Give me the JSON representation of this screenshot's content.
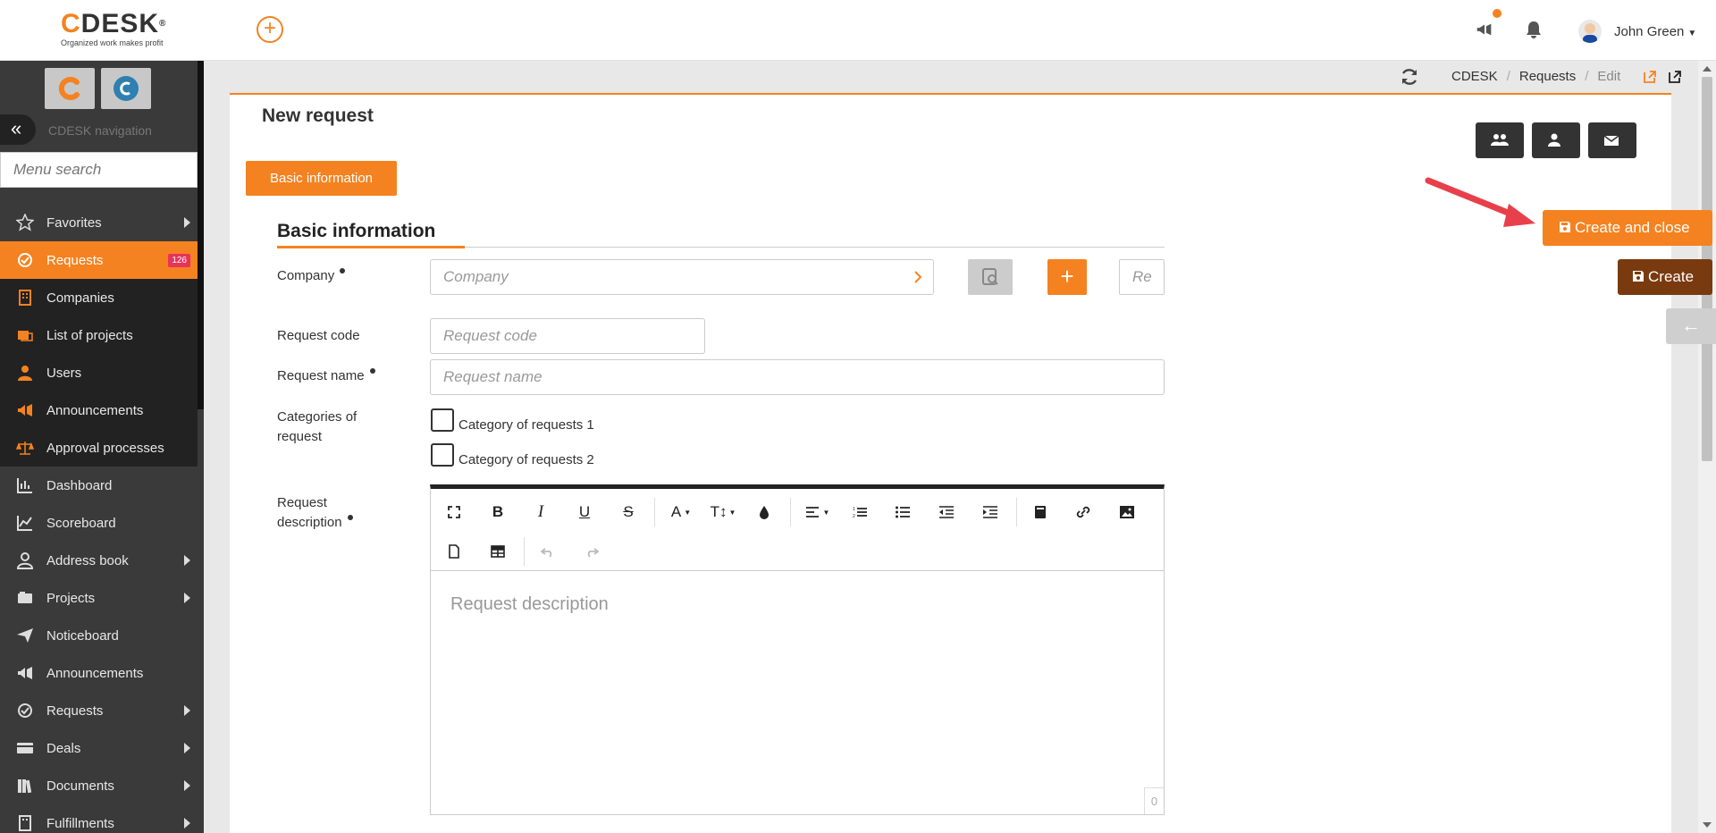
{
  "header": {
    "logo_text": "DESK",
    "logo_letter": "C",
    "logo_trademark": "®",
    "tagline": "Organized work makes profit",
    "user_name": "John Green"
  },
  "sidebar": {
    "nav_label": "CDESK navigation",
    "search_placeholder": "Menu search",
    "items": [
      {
        "label": "Favorites",
        "icon": "star-icon",
        "arrow": true
      },
      {
        "label": "Requests",
        "icon": "requests-icon",
        "badge": "126",
        "active": true
      },
      {
        "label": "Companies",
        "icon": "building-icon"
      },
      {
        "label": "List of projects",
        "icon": "projects-list-icon"
      },
      {
        "label": "Users",
        "icon": "user-icon"
      },
      {
        "label": "Announcements",
        "icon": "megaphone-icon"
      },
      {
        "label": "Approval processes",
        "icon": "scales-icon"
      },
      {
        "label": "Dashboard",
        "icon": "dashboard-icon"
      },
      {
        "label": "Scoreboard",
        "icon": "chart-line-icon"
      },
      {
        "label": "Address book",
        "icon": "address-book-icon",
        "arrow": true
      },
      {
        "label": "Projects",
        "icon": "projects-icon",
        "arrow": true
      },
      {
        "label": "Noticeboard",
        "icon": "paper-plane-icon"
      },
      {
        "label": "Announcements",
        "icon": "megaphone-outline-icon"
      },
      {
        "label": "Requests",
        "icon": "requests-outline-icon",
        "arrow": true
      },
      {
        "label": "Deals",
        "icon": "card-icon",
        "arrow": true
      },
      {
        "label": "Documents",
        "icon": "books-icon",
        "arrow": true
      },
      {
        "label": "Fulfillments",
        "icon": "building-outline-icon",
        "arrow": true
      }
    ]
  },
  "breadcrumb": {
    "items": [
      "CDESK",
      "Requests",
      "Edit"
    ]
  },
  "page": {
    "title": "New request",
    "tab_label": "Basic information",
    "section_title": "Basic information"
  },
  "form": {
    "company_label": "Company",
    "company_placeholder": "Company",
    "re_placeholder": "Re",
    "request_code_label": "Request code",
    "request_code_placeholder": "Request code",
    "request_name_label": "Request name",
    "request_name_placeholder": "Request name",
    "categories_label_1": "Categories of",
    "categories_label_2": "request",
    "category_1": "Category of requests 1",
    "category_2": "Category of requests 2",
    "description_label_1": "Request",
    "description_label_2": "description",
    "description_placeholder": "Request description",
    "char_count": "0"
  },
  "actions": {
    "create_close_label": "Create and close",
    "create_label": "Create",
    "back_label": "←"
  },
  "colors": {
    "accent": "#f58220",
    "sidebar_bg": "#3a3a3a",
    "create_dark": "#7a3a0f",
    "badge": "#e8335a",
    "annotation_arrow": "#e8404a"
  }
}
